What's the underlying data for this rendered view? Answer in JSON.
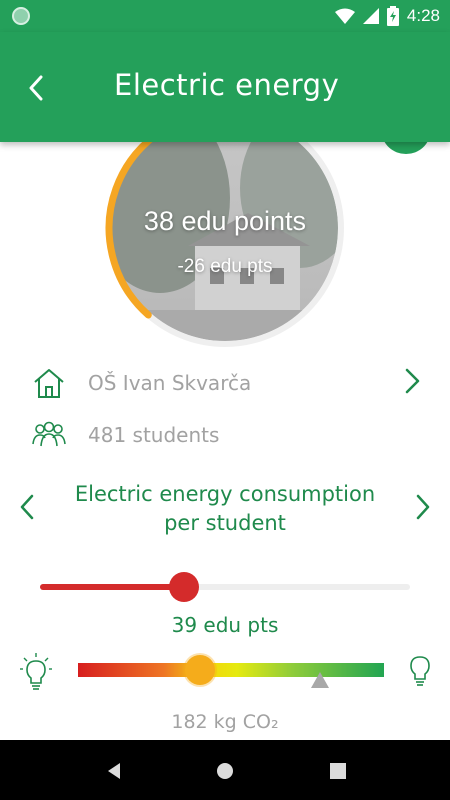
{
  "status_bar": {
    "time": "4:28"
  },
  "app_bar": {
    "title": "Electric energy"
  },
  "hero": {
    "points_label": "38 edu points",
    "delta_label": "-26 edu pts",
    "progress_fraction": 0.38,
    "ring_color": "#f5a623"
  },
  "school": {
    "name": "OŠ Ivan Skvarča",
    "students": "481 students"
  },
  "metric": {
    "title_line1": "Electric energy consumption",
    "title_line2": "per student"
  },
  "slider": {
    "value_label": "39 edu pts",
    "fraction": 0.39,
    "color": "#d42b2b"
  },
  "scale": {
    "co2_label": "182 kg CO₂",
    "current_fraction": 0.4,
    "target_fraction": 0.79
  },
  "colors": {
    "brand_green": "#24a05a",
    "text_green": "#1f8a4c",
    "muted": "#a2a2a2"
  }
}
